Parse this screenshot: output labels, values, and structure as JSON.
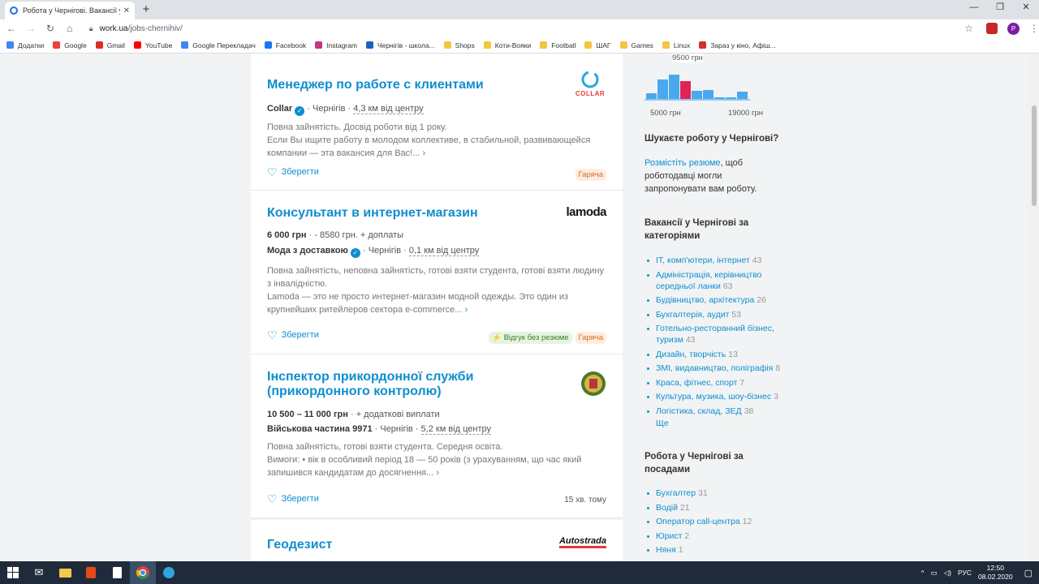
{
  "browser": {
    "tab_title": "Робота у Чернігові. Вакансії у Ч",
    "url_host": "work.ua",
    "url_path": "/jobs-chernihiv/",
    "bookmarks": [
      {
        "label": "Додатки",
        "color": "#4285f4"
      },
      {
        "label": "Google",
        "color": "#ea4335"
      },
      {
        "label": "Gmail",
        "color": "#d93025"
      },
      {
        "label": "YouTube",
        "color": "#ff0000"
      },
      {
        "label": "Google Перекладач",
        "color": "#4285f4"
      },
      {
        "label": "Facebook",
        "color": "#1877f2"
      },
      {
        "label": "Instagram",
        "color": "#c13584"
      },
      {
        "label": "Чернігів - школа...",
        "color": "#1565c0"
      },
      {
        "label": "Shops",
        "color": "#f4c542"
      },
      {
        "label": "Коти-Вояки",
        "color": "#f4c542"
      },
      {
        "label": "Football",
        "color": "#f4c542"
      },
      {
        "label": "ШАГ",
        "color": "#f4c542"
      },
      {
        "label": "Games",
        "color": "#f4c542"
      },
      {
        "label": "Linux",
        "color": "#f4c542"
      },
      {
        "label": "Зараз у кіно, Афіш...",
        "color": "#d32f2f"
      }
    ],
    "profile_letter": "P"
  },
  "jobs": [
    {
      "title": "Менеджер по работе с клиентами",
      "company": "Collar",
      "city": "Чернігів",
      "distance": "4,3 км від центру",
      "desc1": "Повна зайнятість. Досвід роботи від 1 року.",
      "desc2": "Если Вы ищите работу в молодом коллективе, в стабильной, развивающейся компании — эта вакансия для Вас!...",
      "save": "Зберегти",
      "tag_hot": "Гаряча",
      "logo_text": "COLLAR"
    },
    {
      "title": "Консультант в интернет-магазин",
      "salary": "6 000 грн",
      "salary_extra": "- 8580 грн. + доплаты",
      "company": "Мода з доставкою",
      "city": "Чернігів",
      "distance": "0,1 км від центру",
      "desc1": "Повна зайнятість, неповна зайнятість, готові взяти студента, готові взяти людину з інвалідністю.",
      "desc2": "Lamoda — это не просто интернет-магазин модной одежды. Это один из крупнейших ритейлеров сектора e-commerce...",
      "save": "Зберегти",
      "tag_nores": "⚡ Відгук без резюме",
      "tag_hot": "Гаряча",
      "logo_text": "lamoda"
    },
    {
      "title": "Інспектор прикордонної служби (прикордонного контролю)",
      "salary": "10 500 – 11 000 грн",
      "salary_extra": "+ додаткові виплати",
      "company": "Військова частина 9971",
      "city": "Чернігів",
      "distance": "5,2 км від центру",
      "desc1": "Повна зайнятість, готові взяти студента. Середня освіта.",
      "desc2": "Вимоги: • вік в особливий період 18 — 50 років (з урахуванням, що час який запишився кандидатам до досягнення...",
      "save": "Зберегти",
      "ago": "15 хв. тому"
    },
    {
      "title": "Геодезист",
      "logo_text": "Autostrada"
    }
  ],
  "sidebar": {
    "hist_popup": "9500 грн",
    "hist_min": "5000 грн",
    "hist_max": "19000 грн",
    "hist_bars": [
      0.25,
      0.72,
      0.88,
      0.68,
      0.32,
      0.35,
      0.12,
      0.1,
      0.3
    ],
    "hist_selected_index": 3,
    "q_title": "Шукаєте роботу у Чернігові?",
    "q_link": "Розмістіть резюме",
    "q_text": ", щоб роботодавці могли запропонувати вам роботу.",
    "cat_title": "Вакансії у Чернігові за категоріями",
    "categories": [
      {
        "label": "IT, комп'ютери, інтернет",
        "count": "43"
      },
      {
        "label": "Адміністрація, керівництво середньої ланки",
        "count": "63"
      },
      {
        "label": "Будівництво, архітектура",
        "count": "26"
      },
      {
        "label": "Бухгалтерія, аудит",
        "count": "53"
      },
      {
        "label": "Готельно-ресторанний бізнес, туризм",
        "count": "43"
      },
      {
        "label": "Дизайн, творчість",
        "count": "13"
      },
      {
        "label": "ЗМІ, видавництво, поліграфія",
        "count": "8"
      },
      {
        "label": "Краса, фітнес, спорт",
        "count": "7"
      },
      {
        "label": "Культура, музика, шоу-бізнес",
        "count": "3"
      },
      {
        "label": "Логістика, склад, ЗЕД",
        "count": "38"
      }
    ],
    "cat_more": "Ще",
    "pos_title": "Робота у Чернігові за посадами",
    "positions": [
      {
        "label": "Бухгалтер",
        "count": "31"
      },
      {
        "label": "Водій",
        "count": "21"
      },
      {
        "label": "Оператор call-центра",
        "count": "12"
      },
      {
        "label": "Юрист",
        "count": "2"
      },
      {
        "label": "Няня",
        "count": "1"
      }
    ]
  },
  "taskbar": {
    "lang": "РУС",
    "time": "12:50",
    "date": "08.02.2020"
  }
}
